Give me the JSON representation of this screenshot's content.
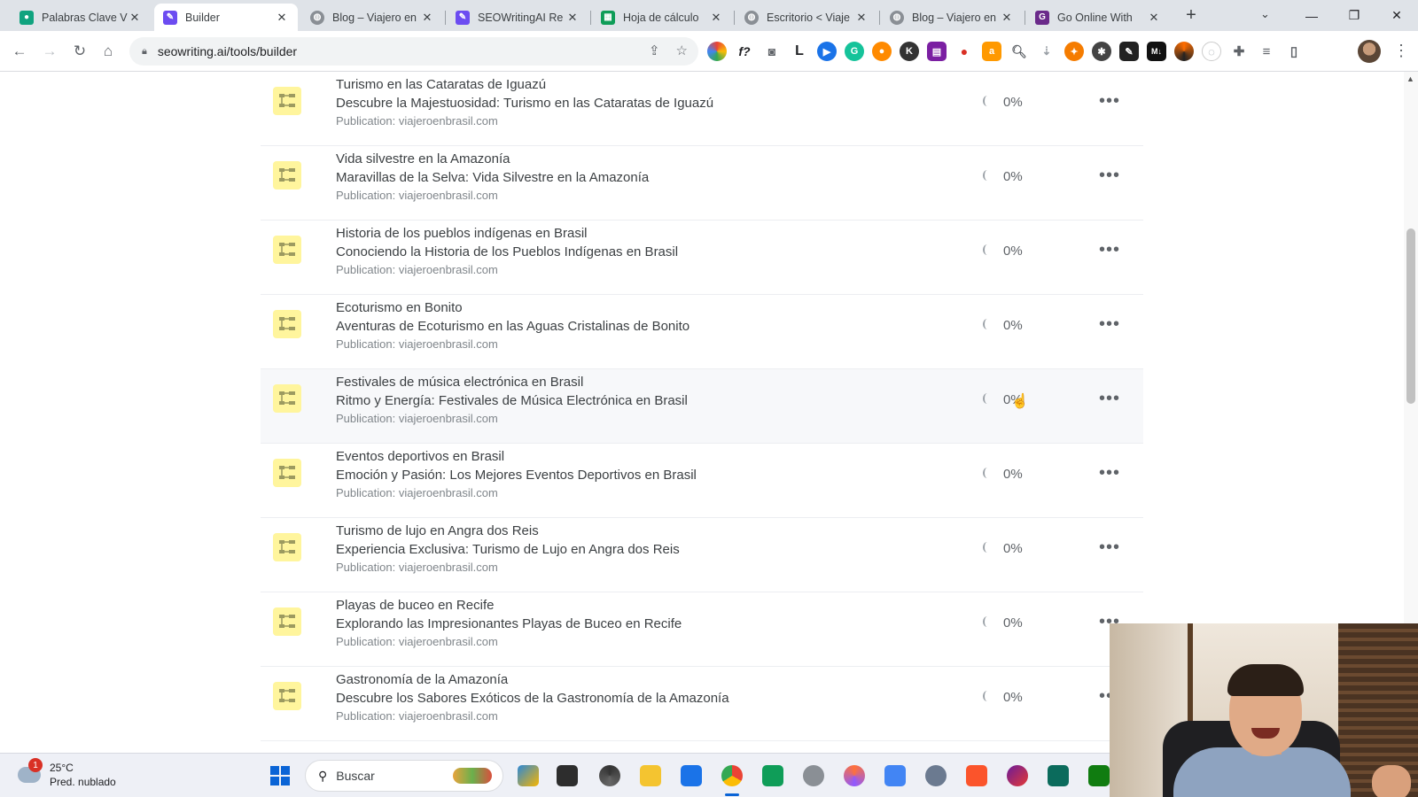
{
  "browser": {
    "tabs": [
      {
        "label": "Palabras Clave V",
        "favicon": "openai-icon",
        "color": "#10a37f"
      },
      {
        "label": "Builder",
        "favicon": "seowriting-icon",
        "color": "#6c4cf1",
        "active": true
      },
      {
        "label": "Blog – Viajero en",
        "favicon": "globe-icon",
        "color": "#5f6368"
      },
      {
        "label": "SEOWritingAI Re",
        "favicon": "seowriting-icon",
        "color": "#6c4cf1"
      },
      {
        "label": "Hoja de cálculo",
        "favicon": "sheets-icon",
        "color": "#0f9d58"
      },
      {
        "label": "Escritorio < Viaje",
        "favicon": "globe-icon",
        "color": "#5f6368"
      },
      {
        "label": "Blog – Viajero en",
        "favicon": "globe-icon",
        "color": "#5f6368"
      },
      {
        "label": "Go Online With",
        "favicon": "godaddy-icon",
        "color": "#6a2a8a"
      }
    ],
    "url": "seowriting.ai/tools/builder"
  },
  "articles": [
    {
      "keyword": "Turismo en las Cataratas de Iguazú",
      "title": "Descubre la Majestuosidad: Turismo en las Cataratas de Iguazú",
      "publication": "Publication: viajeroenbrasil.com",
      "progress": "0%"
    },
    {
      "keyword": "Vida silvestre en la Amazonía",
      "title": "Maravillas de la Selva: Vida Silvestre en la Amazonía",
      "publication": "Publication: viajeroenbrasil.com",
      "progress": "0%"
    },
    {
      "keyword": "Historia de los pueblos indígenas en Brasil",
      "title": "Conociendo la Historia de los Pueblos Indígenas en Brasil",
      "publication": "Publication: viajeroenbrasil.com",
      "progress": "0%"
    },
    {
      "keyword": "Ecoturismo en Bonito",
      "title": "Aventuras de Ecoturismo en las Aguas Cristalinas de Bonito",
      "publication": "Publication: viajeroenbrasil.com",
      "progress": "0%"
    },
    {
      "keyword": "Festivales de música electrónica en Brasil",
      "title": "Ritmo y Energía: Festivales de Música Electrónica en Brasil",
      "publication": "Publication: viajeroenbrasil.com",
      "progress": "0%",
      "hover": true
    },
    {
      "keyword": "Eventos deportivos en Brasil",
      "title": "Emoción y Pasión: Los Mejores Eventos Deportivos en Brasil",
      "publication": "Publication: viajeroenbrasil.com",
      "progress": "0%"
    },
    {
      "keyword": "Turismo de lujo en Angra dos Reis",
      "title": "Experiencia Exclusiva: Turismo de Lujo en Angra dos Reis",
      "publication": "Publication: viajeroenbrasil.com",
      "progress": "0%"
    },
    {
      "keyword": "Playas de buceo en Recife",
      "title": "Explorando las Impresionantes Playas de Buceo en Recife",
      "publication": "Publication: viajeroenbrasil.com",
      "progress": "0%"
    },
    {
      "keyword": "Gastronomía de la Amazonía",
      "title": "Descubre los Sabores Exóticos de la Gastronomía de la Amazonía",
      "publication": "Publication: viajeroenbrasil.com",
      "progress": "0%"
    }
  ],
  "taskbar": {
    "weather_badge": "1",
    "temperature": "25°C",
    "forecast": "Pred. nublado",
    "search_label": "Buscar",
    "apps": [
      "copilot-icon",
      "terminal-icon",
      "chrome-dev-icon",
      "file-explorer-icon",
      "mail-icon",
      "chrome-icon",
      "sheets-app-icon",
      "settings-icon",
      "firefox-icon",
      "docs-icon",
      "gear-icon",
      "brave-icon",
      "headset-icon",
      "terminal2-icon",
      "xbox-icon"
    ]
  },
  "colors": {
    "accent": "#0a64d6",
    "row_icon_bg": "#fff59d",
    "text": "#3c4043"
  }
}
